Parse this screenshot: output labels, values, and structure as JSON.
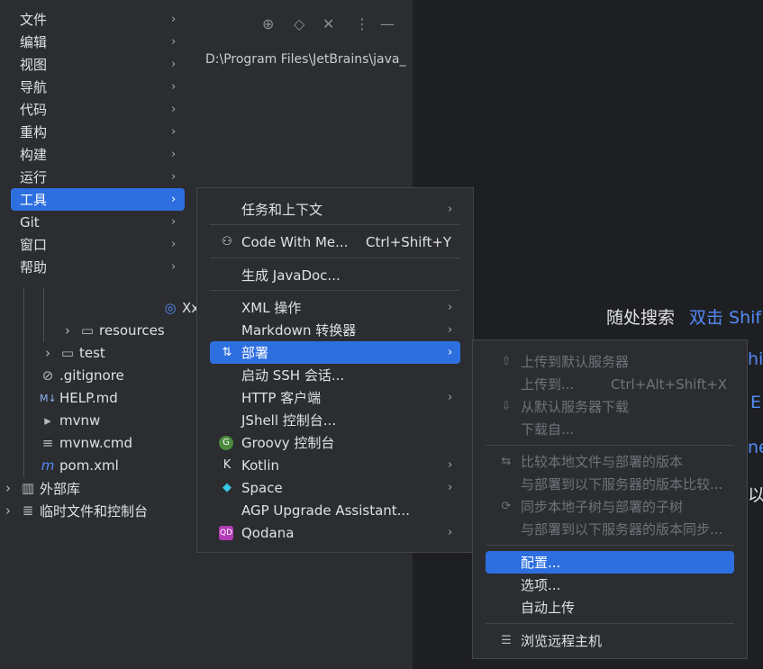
{
  "main_menu": {
    "items": [
      {
        "label": "文件"
      },
      {
        "label": "编辑"
      },
      {
        "label": "视图"
      },
      {
        "label": "导航"
      },
      {
        "label": "代码"
      },
      {
        "label": "重构"
      },
      {
        "label": "构建"
      },
      {
        "label": "运行"
      },
      {
        "label": "工具"
      },
      {
        "label": "Git"
      },
      {
        "label": "窗口"
      },
      {
        "label": "帮助"
      }
    ]
  },
  "tools_menu": {
    "items": [
      {
        "label": "任务和上下文"
      },
      {
        "label": "Code With Me...",
        "shortcut": "Ctrl+Shift+Y"
      },
      {
        "label": "生成 JavaDoc..."
      },
      {
        "label": "XML 操作"
      },
      {
        "label": "Markdown 转换器"
      },
      {
        "label": "部署"
      },
      {
        "label": "启动 SSH 会话..."
      },
      {
        "label": "HTTP 客户端"
      },
      {
        "label": "JShell 控制台..."
      },
      {
        "label": "Groovy 控制台"
      },
      {
        "label": "Kotlin"
      },
      {
        "label": "Space"
      },
      {
        "label": "AGP Upgrade Assistant..."
      },
      {
        "label": "Qodana"
      }
    ]
  },
  "deploy_menu": {
    "items": [
      {
        "label": "上传到默认服务器"
      },
      {
        "label": "上传到...",
        "shortcut": "Ctrl+Alt+Shift+X"
      },
      {
        "label": "从默认服务器下载"
      },
      {
        "label": "下载自..."
      },
      {
        "label": "比较本地文件与部署的版本"
      },
      {
        "label": "与部署到以下服务器的版本比较..."
      },
      {
        "label": "同步本地子树与部署的子树"
      },
      {
        "label": "与部署到以下服务器的版本同步..."
      },
      {
        "label": "配置..."
      },
      {
        "label": "选项..."
      },
      {
        "label": "自动上传"
      },
      {
        "label": "浏览远程主机"
      }
    ]
  },
  "background": {
    "path": "D:\\Program Files\\JetBrains\\java_",
    "tree": {
      "xx_partial": "Xx",
      "resources": "resources",
      "test": "test",
      "gitignore": ".gitignore",
      "help": "HELP.md",
      "mvnw": "mvnw",
      "mvnw_cmd": "mvnw.cmd",
      "pom": "pom.xml",
      "external": "外部库",
      "scratches": "临时文件和控制台"
    },
    "right": {
      "search_label": "随处搜索",
      "search_hint": "双击 Shif",
      "frag1": "hif",
      "frag2": "E",
      "frag3": "ne",
      "frag4": "以"
    }
  },
  "colors": {
    "accent": "#2e6fe0",
    "menu_bg": "#2b2d30",
    "link": "#548af7"
  }
}
